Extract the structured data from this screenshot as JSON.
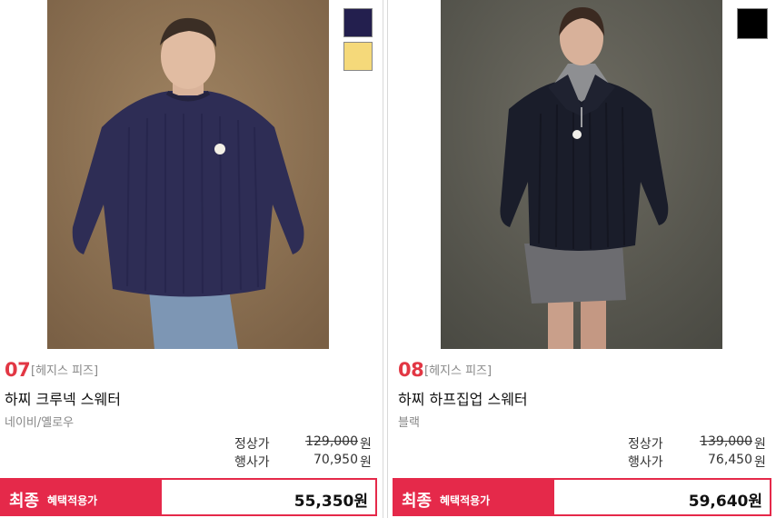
{
  "products": [
    {
      "number": "07",
      "brand": "[헤지스 피즈]",
      "name": "하찌 크루넥 스웨터",
      "color_text": "네이비/옐로우",
      "swatches": [
        "#231f4e",
        "#f5d97a"
      ],
      "regular_label": "정상가",
      "regular_price": "129,000",
      "sale_label": "행사가",
      "sale_price": "70,950",
      "currency": "원",
      "final_tag": "최종",
      "final_sub": "혜택적용가",
      "final_price": "55,350원"
    },
    {
      "number": "08",
      "brand": "[헤지스 피즈]",
      "name": "하찌 하프집업 스웨터",
      "color_text": "블랙",
      "swatches": [
        "#000000"
      ],
      "regular_label": "정상가",
      "regular_price": "139,000",
      "sale_label": "행사가",
      "sale_price": "76,450",
      "currency": "원",
      "final_tag": "최종",
      "final_sub": "혜택적용가",
      "final_price": "59,640원"
    }
  ],
  "colors": {
    "accent_red": "#e5294a",
    "number_red": "#e23744"
  }
}
